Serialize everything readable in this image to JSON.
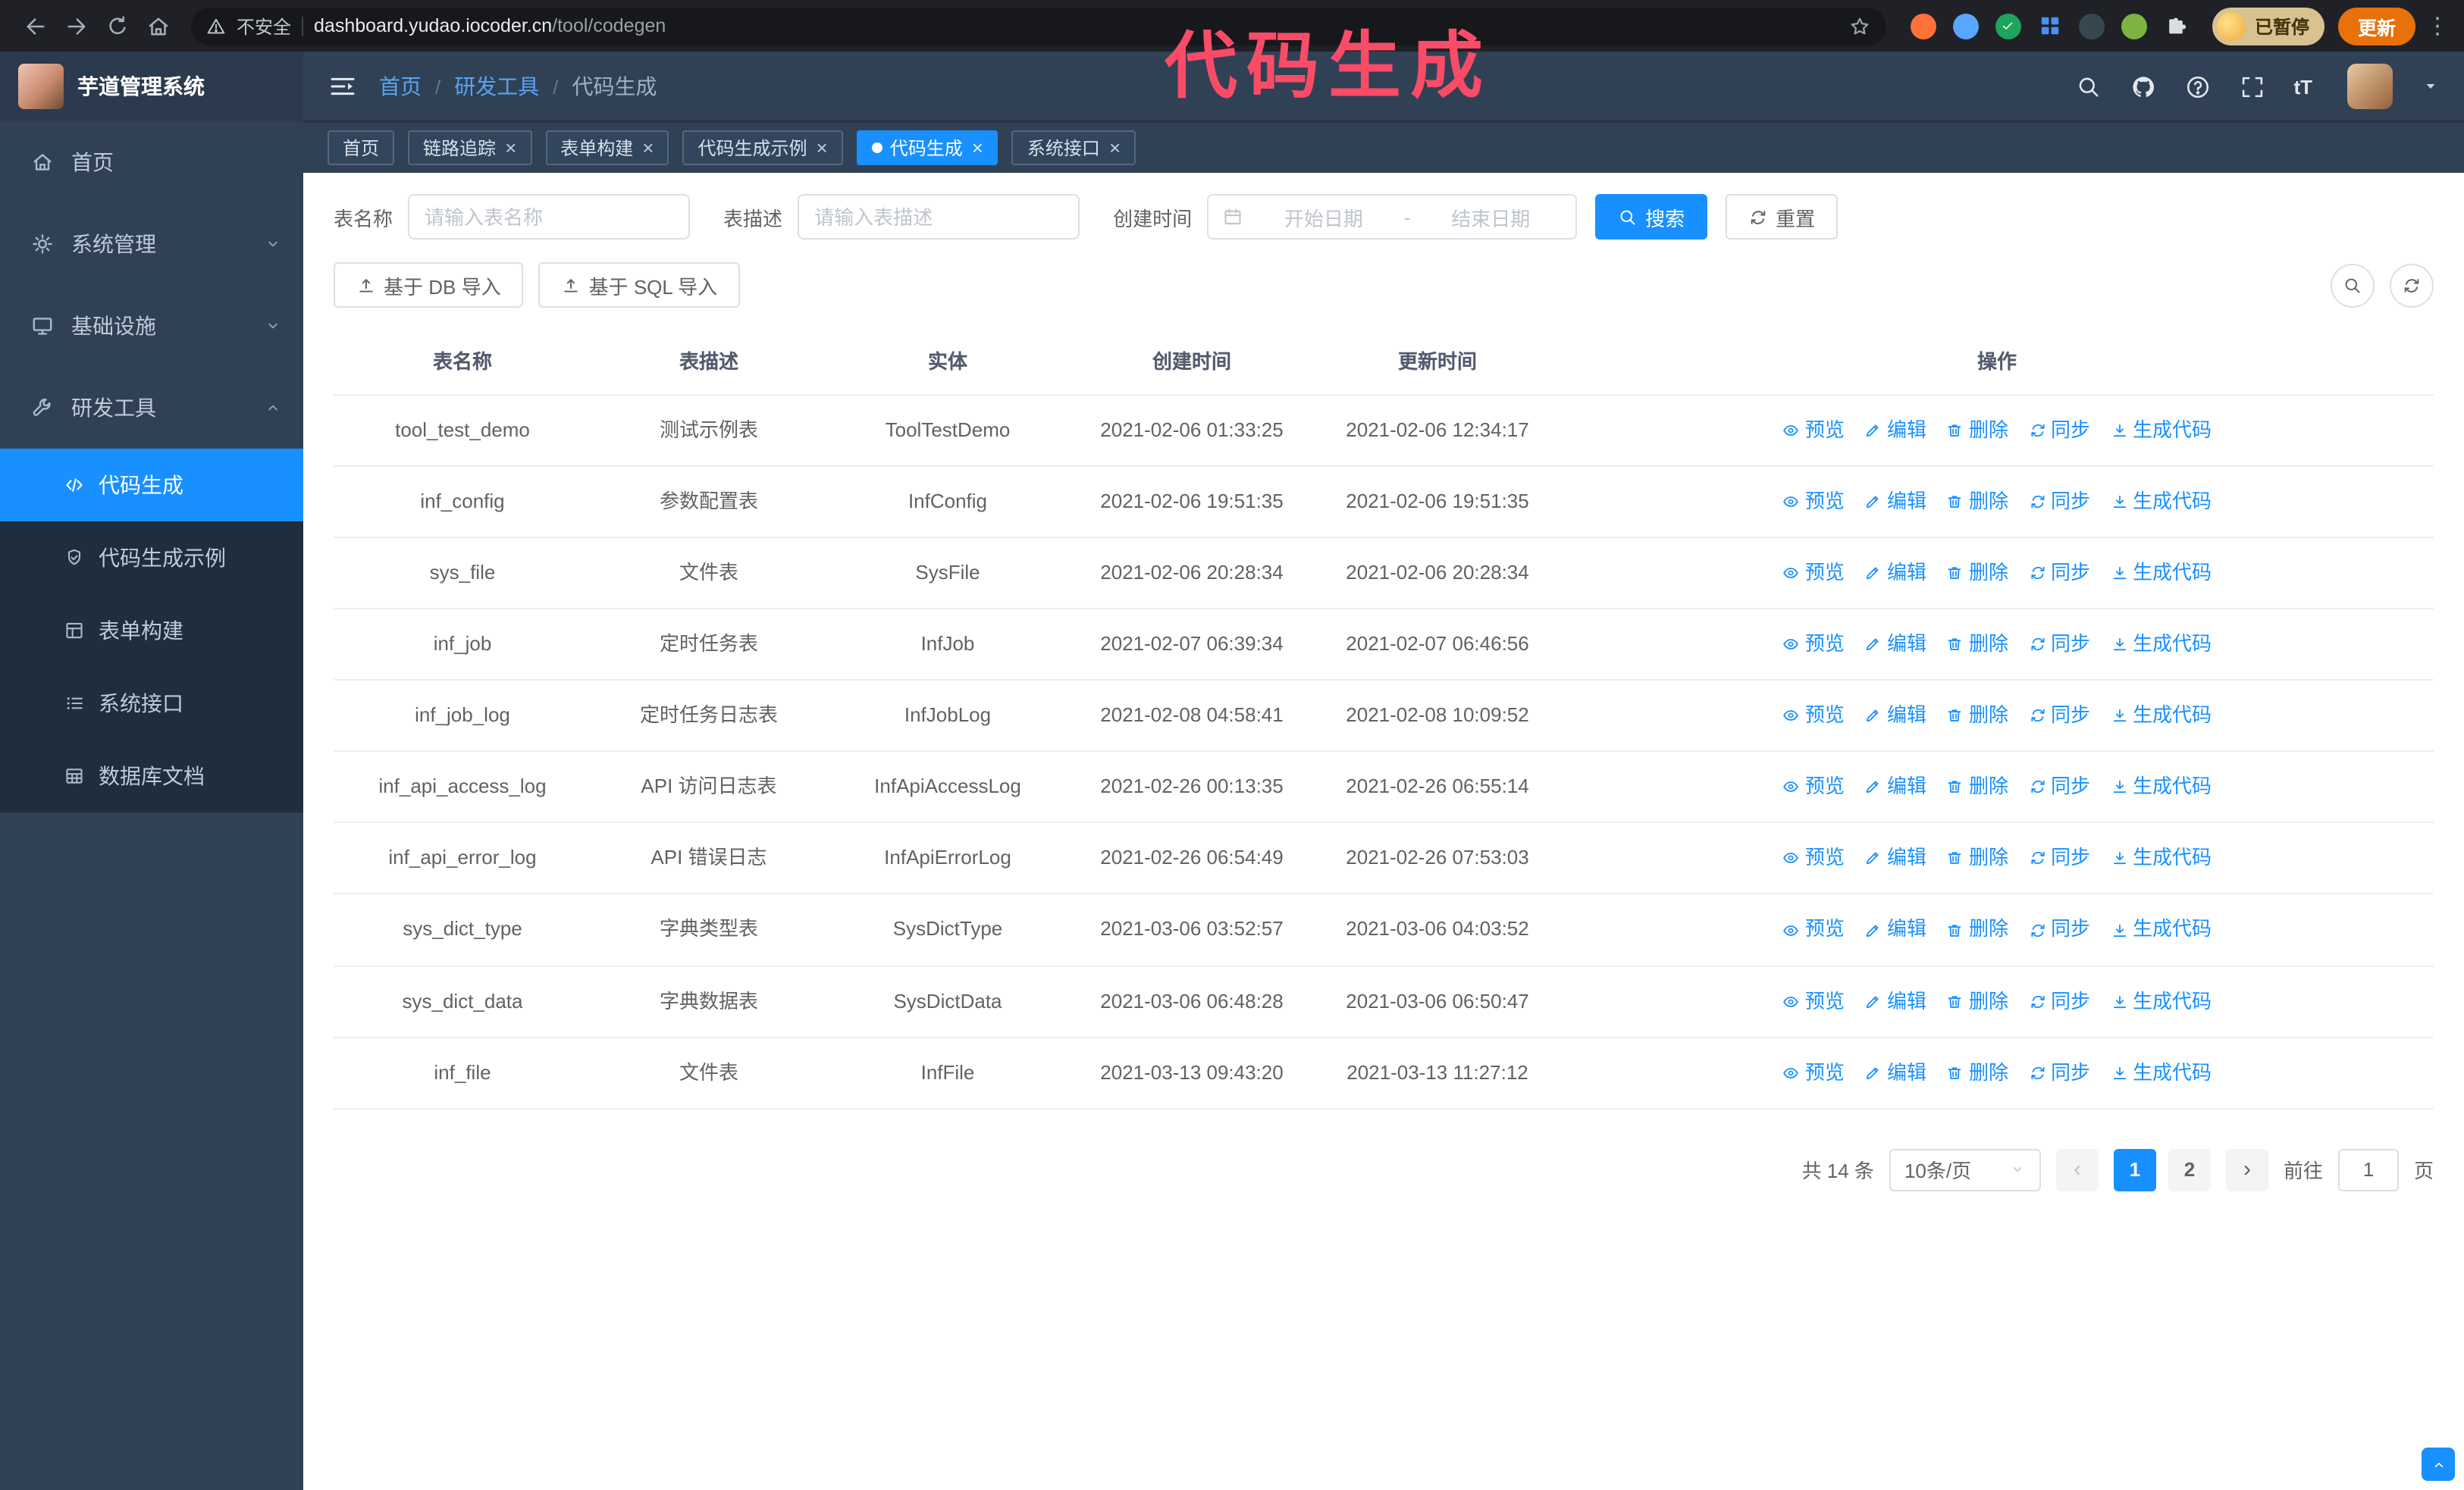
{
  "theme": {
    "accent": "#1890ff",
    "sidebar_bg": "#304156",
    "annotation_color": "#fa4b67"
  },
  "browser": {
    "security_label": "不安全",
    "url_host": "dashboard.yudao.iocoder.cn",
    "url_path": "/tool/codegen",
    "profile_badge": "已暂停",
    "update_label": "更新"
  },
  "annotation": {
    "text": "代码生成"
  },
  "sidebar": {
    "app_title": "芋道管理系统",
    "menu": [
      {
        "id": "home",
        "label": "首页",
        "icon": "home",
        "expandable": false,
        "expanded": false
      },
      {
        "id": "system",
        "label": "系统管理",
        "icon": "gear",
        "expandable": true,
        "expanded": false
      },
      {
        "id": "infra",
        "label": "基础设施",
        "icon": "monitor",
        "expandable": true,
        "expanded": false
      },
      {
        "id": "devtools",
        "label": "研发工具",
        "icon": "wrench",
        "expandable": true,
        "expanded": true,
        "children": [
          {
            "id": "codegen",
            "label": "代码生成",
            "icon": "code",
            "active": true
          },
          {
            "id": "codegen-example",
            "label": "代码生成示例",
            "icon": "badge",
            "active": false
          },
          {
            "id": "form-builder",
            "label": "表单构建",
            "icon": "form",
            "active": false
          },
          {
            "id": "system-api",
            "label": "系统接口",
            "icon": "api",
            "active": false
          },
          {
            "id": "db-doc",
            "label": "数据库文档",
            "icon": "table",
            "active": false
          }
        ]
      }
    ]
  },
  "header": {
    "breadcrumb": [
      "首页",
      "研发工具",
      "代码生成"
    ]
  },
  "tags": [
    {
      "id": "home",
      "label": "首页",
      "closable": false,
      "active": false
    },
    {
      "id": "tracer",
      "label": "链路追踪",
      "closable": true,
      "active": false
    },
    {
      "id": "form-builder",
      "label": "表单构建",
      "closable": true,
      "active": false
    },
    {
      "id": "codegen-example",
      "label": "代码生成示例",
      "closable": true,
      "active": false
    },
    {
      "id": "codegen",
      "label": "代码生成",
      "closable": true,
      "active": true
    },
    {
      "id": "system-api",
      "label": "系统接口",
      "closable": true,
      "active": false
    }
  ],
  "filters": {
    "name_label": "表名称",
    "name_placeholder": "请输入表名称",
    "desc_label": "表描述",
    "desc_placeholder": "请输入表描述",
    "time_label": "创建时间",
    "start_placeholder": "开始日期",
    "range_separator": "-",
    "end_placeholder": "结束日期",
    "search_button": "搜索",
    "reset_button": "重置"
  },
  "toolbar": {
    "import_db_label": "基于 DB 导入",
    "import_sql_label": "基于 SQL 导入"
  },
  "table": {
    "columns": [
      "表名称",
      "表描述",
      "实体",
      "创建时间",
      "更新时间",
      "操作"
    ],
    "actions": [
      {
        "id": "preview",
        "label": "预览",
        "icon": "eye"
      },
      {
        "id": "edit",
        "label": "编辑",
        "icon": "edit"
      },
      {
        "id": "delete",
        "label": "删除",
        "icon": "trash"
      },
      {
        "id": "sync",
        "label": "同步",
        "icon": "refresh"
      },
      {
        "id": "generate",
        "label": "生成代码",
        "icon": "download"
      }
    ],
    "rows": [
      {
        "name": "tool_test_demo",
        "desc": "测试示例表",
        "entity": "ToolTestDemo",
        "create_time": "2021-02-06 01:33:25",
        "update_time": "2021-02-06 12:34:17"
      },
      {
        "name": "inf_config",
        "desc": "参数配置表",
        "entity": "InfConfig",
        "create_time": "2021-02-06 19:51:35",
        "update_time": "2021-02-06 19:51:35"
      },
      {
        "name": "sys_file",
        "desc": "文件表",
        "entity": "SysFile",
        "create_time": "2021-02-06 20:28:34",
        "update_time": "2021-02-06 20:28:34"
      },
      {
        "name": "inf_job",
        "desc": "定时任务表",
        "entity": "InfJob",
        "create_time": "2021-02-07 06:39:34",
        "update_time": "2021-02-07 06:46:56"
      },
      {
        "name": "inf_job_log",
        "desc": "定时任务日志表",
        "entity": "InfJobLog",
        "create_time": "2021-02-08 04:58:41",
        "update_time": "2021-02-08 10:09:52"
      },
      {
        "name": "inf_api_access_log",
        "desc": "API 访问日志表",
        "entity": "InfApiAccessLog",
        "create_time": "2021-02-26 00:13:35",
        "update_time": "2021-02-26 06:55:14"
      },
      {
        "name": "inf_api_error_log",
        "desc": "API 错误日志",
        "entity": "InfApiErrorLog",
        "create_time": "2021-02-26 06:54:49",
        "update_time": "2021-02-26 07:53:03"
      },
      {
        "name": "sys_dict_type",
        "desc": "字典类型表",
        "entity": "SysDictType",
        "create_time": "2021-03-06 03:52:57",
        "update_time": "2021-03-06 04:03:52"
      },
      {
        "name": "sys_dict_data",
        "desc": "字典数据表",
        "entity": "SysDictData",
        "create_time": "2021-03-06 06:48:28",
        "update_time": "2021-03-06 06:50:47"
      },
      {
        "name": "inf_file",
        "desc": "文件表",
        "entity": "InfFile",
        "create_time": "2021-03-13 09:43:20",
        "update_time": "2021-03-13 11:27:12"
      }
    ]
  },
  "pagination": {
    "total_text": "共 14 条",
    "page_size": "10条/页",
    "pages": [
      "1",
      "2"
    ],
    "active_page": "1",
    "goto_label": "前往",
    "goto_value": "1",
    "unit_label": "页"
  }
}
